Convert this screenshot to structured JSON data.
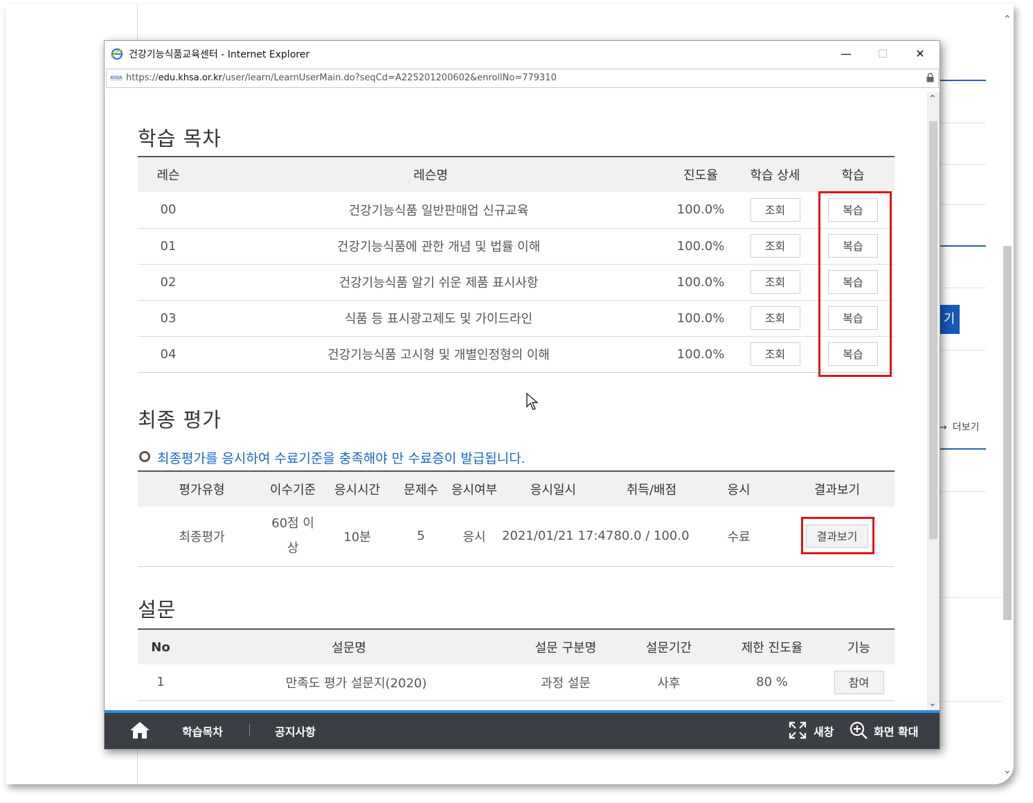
{
  "background_page": {
    "blue_button_label": "기",
    "more_label": "더보기"
  },
  "window": {
    "title": "건강기능식품교육센터 - Internet Explorer",
    "url_prefix": "https://",
    "url_domain": "edu.khsa.or.kr",
    "url_path": "/user/learn/LearnUserMain.do?seqCd=A225201200602&enrollNo=779310",
    "site_icon_text": "KHSA",
    "minimize": "—",
    "maximize": "☐",
    "close": "✕"
  },
  "toc": {
    "title": "학습 목차",
    "headers": [
      "레슨",
      "레슨명",
      "진도율",
      "학습 상세",
      "학습"
    ],
    "rows": [
      {
        "no": "00",
        "name": "건강기능식품 일반판매업 신규교육",
        "progress": "100.0%",
        "detail": "조회",
        "study": "복습"
      },
      {
        "no": "01",
        "name": "건강기능식품에 관한 개념 및 법률 이해",
        "progress": "100.0%",
        "detail": "조회",
        "study": "복습"
      },
      {
        "no": "02",
        "name": "건강기능식품 알기 쉬운 제품 표시사항",
        "progress": "100.0%",
        "detail": "조회",
        "study": "복습"
      },
      {
        "no": "03",
        "name": "식품 등 표시광고제도 및 가이드라인",
        "progress": "100.0%",
        "detail": "조회",
        "study": "복습"
      },
      {
        "no": "04",
        "name": "건강기능식품 고시형 및 개별인정형의 이해",
        "progress": "100.0%",
        "detail": "조회",
        "study": "복습"
      }
    ]
  },
  "final_eval": {
    "title": "최종 평가",
    "notice": "최종평가를 응시하여 수료기준을 충족해야 만 수료증이 발급됩니다.",
    "headers": [
      "평가유형",
      "이수기준",
      "응시시간",
      "문제수",
      "응시여부",
      "응시일시",
      "취득/배점",
      "응시",
      "결과보기"
    ],
    "row": {
      "type": "최종평가",
      "criteria_line1": "60점 이",
      "criteria_line2": "상",
      "time": "10분",
      "questions": "5",
      "taken": "응시",
      "datetime": "2021/01/21 17:47",
      "score": "80.0 / 100.0",
      "status": "수료",
      "result_button": "결과보기"
    }
  },
  "survey": {
    "title": "설문",
    "headers": [
      "No",
      "설문명",
      "설문 구분명",
      "설문기간",
      "제한 진도율",
      "기능"
    ],
    "rows": [
      {
        "no": "1",
        "name": "만족도 평가 설문지(2020)",
        "category": "과정 설문",
        "period": "사후",
        "limit": "80 %",
        "action": "참여"
      }
    ]
  },
  "footer": {
    "toc_label": "학습목차",
    "notice_label": "공지사항",
    "new_window_label": "새창",
    "zoom_label": "화면 확대"
  },
  "colors": {
    "highlight_red": "#e01414",
    "notice_blue": "#1a66c2",
    "footer_bg": "#3b3e44",
    "footer_accent": "#2f8ee6"
  }
}
